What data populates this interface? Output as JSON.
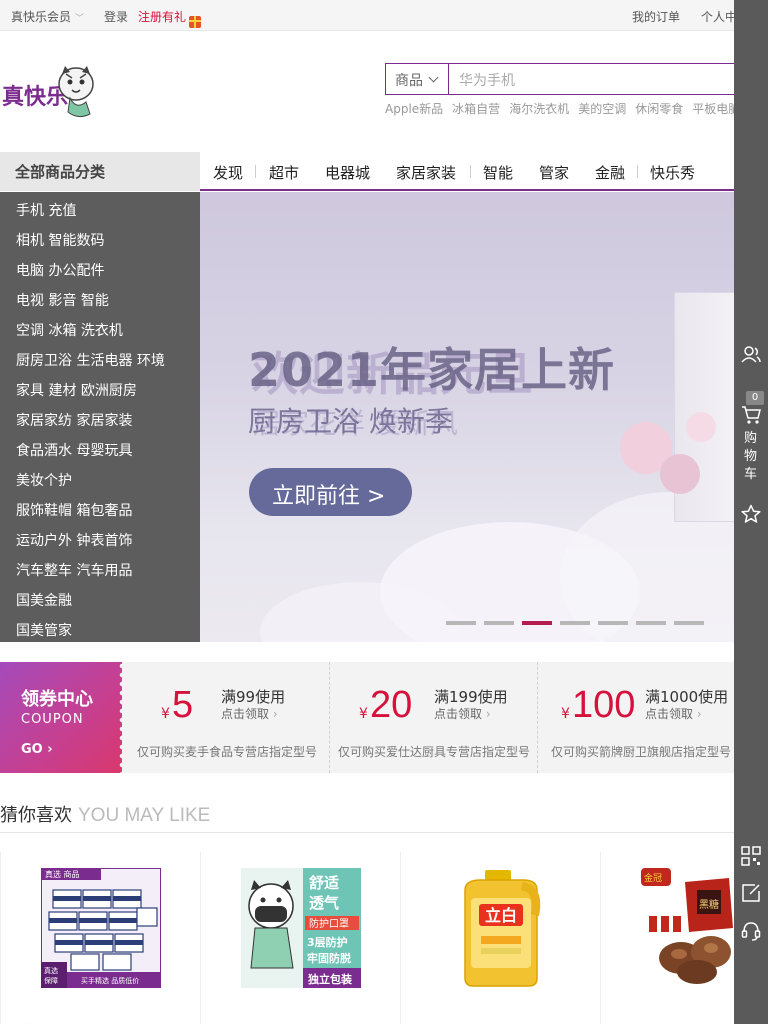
{
  "topbar": {
    "member_label": "真快乐会员",
    "login_label": "登录",
    "register_label": "注册有礼",
    "orders_label": "我的订单",
    "personal_label": "个人中"
  },
  "search": {
    "type_label": "商品",
    "placeholder": "华为手机",
    "hot_words": [
      "Apple新品",
      "冰箱自营",
      "海尔洗衣机",
      "美的空调",
      "休闲零食",
      "平板电脑"
    ]
  },
  "nav": {
    "category_header": "全部商品分类",
    "links": [
      "发现",
      "超市",
      "电器城",
      "家居家装",
      "智能",
      "管家",
      "金融",
      "快乐秀"
    ]
  },
  "categories": [
    "手机 充值",
    "相机 智能数码",
    "电脑 办公配件",
    "电视 影音 智能",
    "空调 冰箱 洗衣机",
    "厨房卫浴 生活电器 环境",
    "家具 建材 欧洲厨房",
    "家居家纺 家居家装",
    "食品酒水 母婴玩具",
    "美妆个护",
    "服饰鞋帽 箱包奢品",
    "运动户外 钟表首饰",
    "汽车整车 汽车用品",
    "国美金融",
    "国美管家"
  ],
  "banner": {
    "title_primary": "2021年家居上新",
    "title_secondary": "欢迎新品元旦",
    "subtitle_primary": "厨房卫浴 焕新季",
    "subtitle_secondary": "居家花样 爱新风",
    "button_label": "立即前往 >",
    "slide_count": 7,
    "active_slide": 3
  },
  "coupon_center": {
    "title": "领券中心",
    "subtitle": "COUPON",
    "go_label": "GO",
    "coupons": [
      {
        "currency": "¥",
        "amount": "5",
        "condition": "满99使用",
        "action": "点击领取",
        "description": "仅可购买麦手食品专营店指定型号"
      },
      {
        "currency": "¥",
        "amount": "20",
        "condition": "满199使用",
        "action": "点击领取",
        "description": "仅可购买爱仕达厨具专营店指定型号"
      },
      {
        "currency": "¥",
        "amount": "100",
        "condition": "满1000使用",
        "action": "点击领取",
        "description": "仅可购买箭牌厨卫旗舰店指定型号"
      }
    ]
  },
  "recommend": {
    "title_cn": "猜你喜欢",
    "title_en": "YOU MAY LIKE",
    "products": [
      {
        "image_text": "真选 商品",
        "badge": "真选保障",
        "tagline": "买手精选 品质低价"
      },
      {
        "image_text": "舒适透气",
        "features": [
          "防护口罩",
          "3层防护",
          "牢固防脱",
          "独立包装"
        ]
      },
      {
        "image_text": "立白",
        "badge": ""
      },
      {
        "image_text": "金冠",
        "badge": "黑糖"
      }
    ]
  },
  "right_rail": {
    "cart_label": "购物车",
    "cart_count": "0"
  },
  "colors": {
    "accent": "#7a2d8e",
    "price_red": "#d6113c",
    "sidebar_bg": "#5d5d5d",
    "rail_bg": "#5a5a5a"
  }
}
